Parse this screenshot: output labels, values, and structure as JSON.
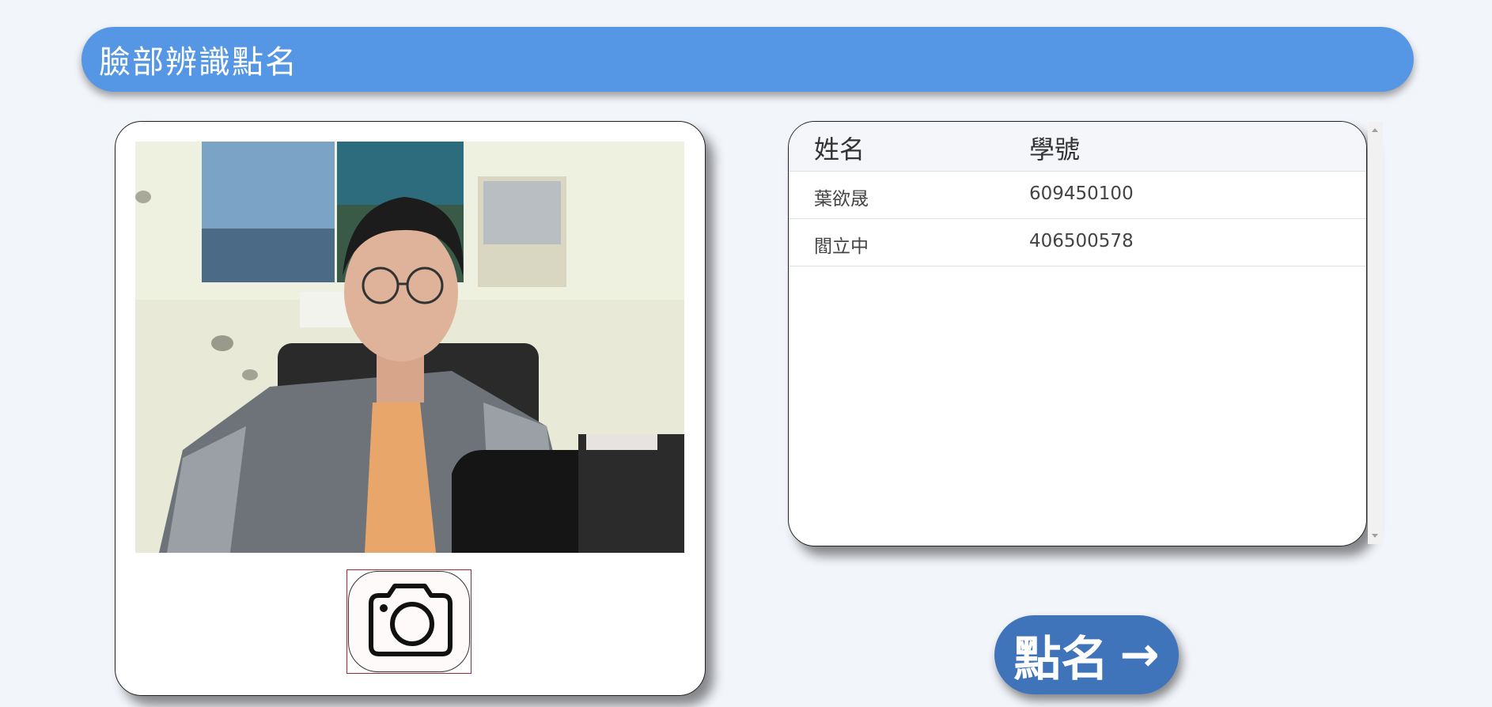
{
  "header": {
    "title": "臉部辨識點名"
  },
  "camera_panel": {
    "video_icon": "webcam-video-feed",
    "capture_icon": "camera-icon"
  },
  "attendance_table": {
    "columns": [
      "姓名",
      "學號"
    ],
    "rows": [
      {
        "name": "葉欲晟",
        "id": "609450100"
      },
      {
        "name": "閻立中",
        "id": "406500578"
      }
    ]
  },
  "actions": {
    "rollcall_label": "點名",
    "rollcall_icon": "arrow-right-icon",
    "arrow_glyph": "→"
  },
  "colors": {
    "header": "#5597e4",
    "rollcall_button": "#3f74bb",
    "background": "#f2f5fa"
  }
}
